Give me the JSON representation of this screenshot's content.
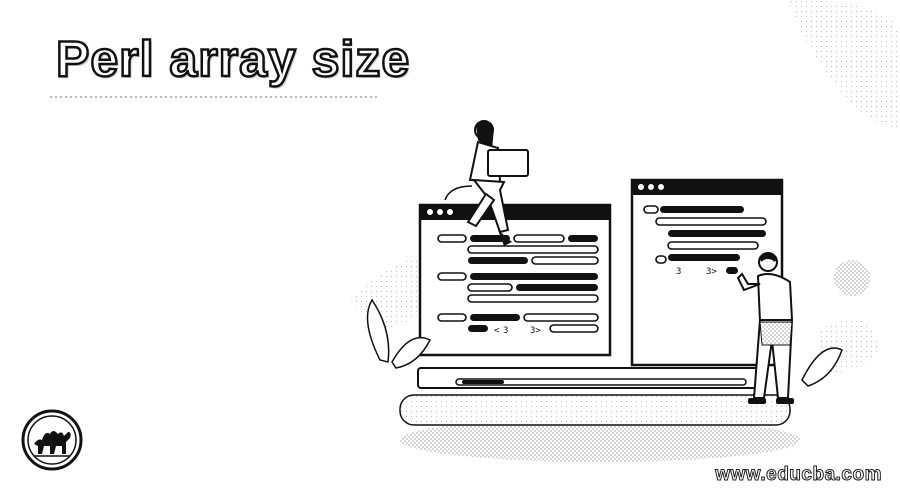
{
  "title": "Perl array size",
  "watermark": "www.educba.com",
  "colors": {
    "ink": "#111111",
    "background": "#ffffff",
    "dither": "#c8c8c8"
  },
  "illustration": {
    "left_window_code_labels": [
      "<",
      "3",
      "3>"
    ],
    "right_window_code_labels": [
      "3",
      "3>"
    ]
  }
}
